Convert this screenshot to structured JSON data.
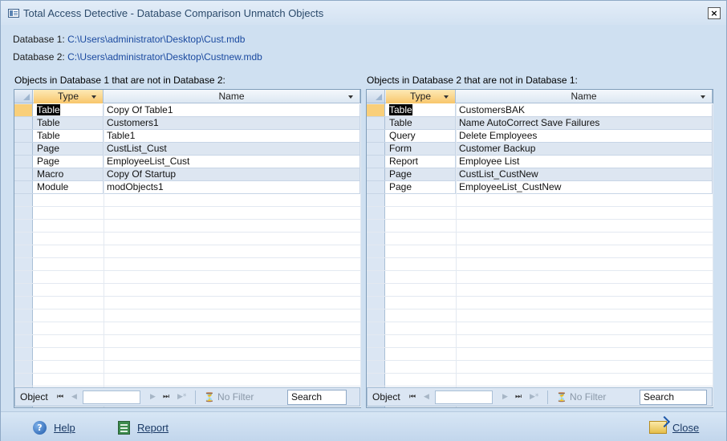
{
  "window": {
    "title": "Total Access Detective - Database Comparison Unmatch Objects",
    "close_glyph": "×"
  },
  "databases": [
    {
      "label": "Database 1:",
      "path": "C:\\Users\\administrator\\Desktop\\Cust.mdb"
    },
    {
      "label": "Database 2:",
      "path": "C:\\Users\\administrator\\Desktop\\Custnew.mdb"
    }
  ],
  "left": {
    "label": "Objects in Database 1 that are not in Database 2:",
    "columns": {
      "type": "Type",
      "name": "Name"
    },
    "rows": [
      {
        "type": "Table",
        "name": "Copy Of Table1"
      },
      {
        "type": "Table",
        "name": "Customers1"
      },
      {
        "type": "Table",
        "name": "Table1"
      },
      {
        "type": "Page",
        "name": "CustList_Cust"
      },
      {
        "type": "Page",
        "name": "EmployeeList_Cust"
      },
      {
        "type": "Macro",
        "name": "Copy Of Startup"
      },
      {
        "type": "Module",
        "name": "modObjects1"
      }
    ]
  },
  "right": {
    "label": "Objects in Database 2 that are not in Database 1:",
    "columns": {
      "type": "Type",
      "name": "Name"
    },
    "rows": [
      {
        "type": "Table",
        "name": "CustomersBAK"
      },
      {
        "type": "Table",
        "name": "Name AutoCorrect Save Failures"
      },
      {
        "type": "Query",
        "name": "Delete Employees"
      },
      {
        "type": "Form",
        "name": "Customer Backup"
      },
      {
        "type": "Report",
        "name": "Employee List"
      },
      {
        "type": "Page",
        "name": "CustList_CustNew"
      },
      {
        "type": "Page",
        "name": "EmployeeList_CustNew"
      }
    ]
  },
  "navigation": {
    "record_label": "Object",
    "first_glyph": "⏮",
    "prev_glyph": "◀",
    "next_glyph": "▶",
    "last_glyph": "⏭",
    "new_glyph": "▶*",
    "no_filter": "No Filter",
    "search_value": "Search"
  },
  "buttons": {
    "help": "Help",
    "report": "Report",
    "close": "Close"
  },
  "colors": {
    "accent_header": "#f8c66b",
    "alt_row": "#dde6f1",
    "window_bg": "#cfe0f1"
  }
}
